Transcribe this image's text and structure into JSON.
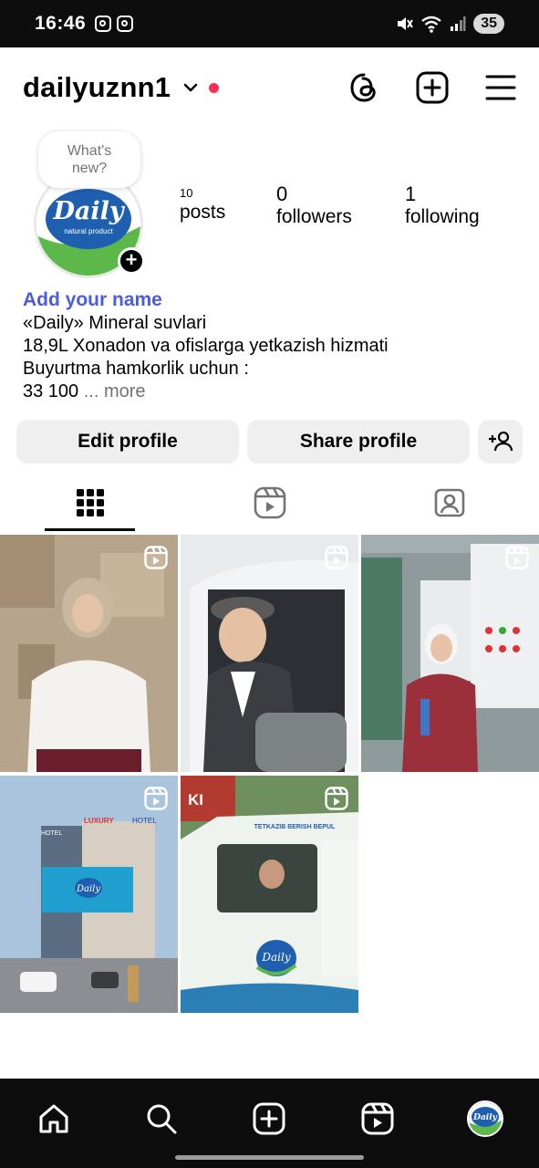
{
  "status_bar": {
    "time": "16:46",
    "battery": "35",
    "icons": [
      "instagram-icon",
      "instagram-icon",
      "mute-icon",
      "wifi-icon",
      "signal-icon"
    ]
  },
  "header": {
    "username": "dailyuznn1",
    "icons": [
      "chevron-down-icon",
      "threads-icon",
      "create-icon",
      "menu-icon"
    ],
    "live_dot_color": "#ff2d55"
  },
  "profile": {
    "note_placeholder": "What's\nnew?",
    "avatar_text": "Daily",
    "avatar_subtext": "natural product",
    "stats": {
      "posts_count": "10",
      "posts_label": "posts",
      "followers_count": "0",
      "followers_label": "followers",
      "following_count": "1",
      "following_label": "following"
    },
    "add_name": "Add your name",
    "bio_lines": [
      "«Daily» Mineral suvlari",
      "18,9L Xonadon va ofislarga yetkazish hizmati",
      "Buyurtma hamkorlik uchun :"
    ],
    "bio_last_line": "33 100",
    "more_label": "... more"
  },
  "buttons": {
    "edit_profile": "Edit profile",
    "share_profile": "Share profile"
  },
  "tabs": [
    "grid-icon",
    "reels-icon",
    "tagged-icon"
  ],
  "grid": {
    "items": [
      {
        "type": "reel",
        "subject": "woman in hijab, white blouse"
      },
      {
        "type": "reel",
        "subject": "man in van window"
      },
      {
        "type": "reel",
        "subject": "woman holding bottle in factory"
      },
      {
        "type": "reel",
        "subject": "billboard near hotel",
        "signs": [
          "LUXURY",
          "HOTEL",
          "HOTEL"
        ]
      },
      {
        "type": "reel",
        "subject": "delivery van",
        "signs": [
          "TETKAZIB BERISH BEPUL",
          "KI"
        ]
      }
    ]
  },
  "bottom_nav": [
    "home-icon",
    "search-icon",
    "create-icon",
    "reels-icon",
    "profile-avatar"
  ],
  "colors": {
    "accent_name": "#4a5de1",
    "button_bg": "#efefef",
    "brand_blue": "#1f5fb0",
    "brand_green": "#5cb848"
  }
}
